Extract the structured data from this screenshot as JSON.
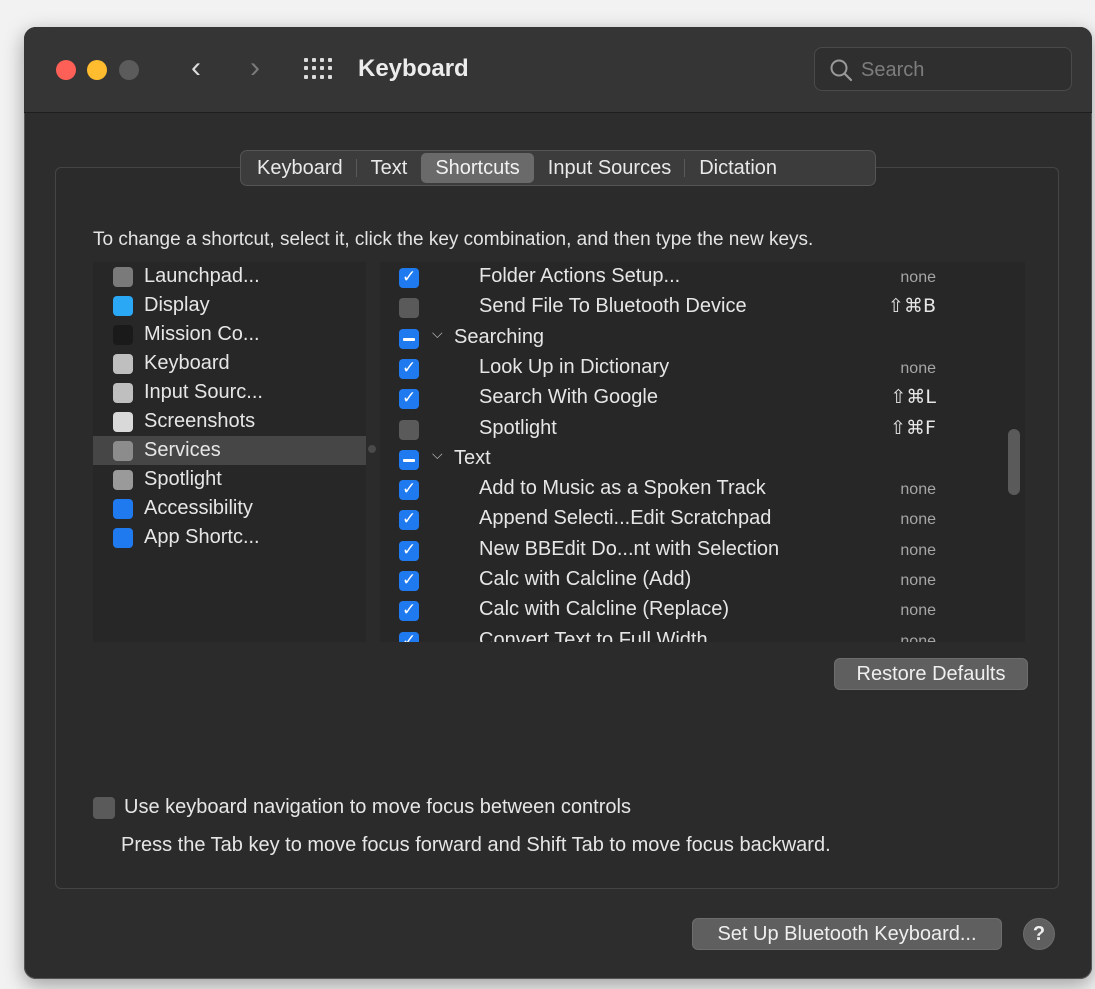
{
  "window": {
    "title": "Keyboard",
    "search_placeholder": "Search"
  },
  "tabs": [
    {
      "label": "Keyboard",
      "active": false
    },
    {
      "label": "Text",
      "active": false
    },
    {
      "label": "Shortcuts",
      "active": true
    },
    {
      "label": "Input Sources",
      "active": false
    },
    {
      "label": "Dictation",
      "active": false
    }
  ],
  "instructions": "To change a shortcut, select it, click the key combination, and then type the new keys.",
  "categories": [
    {
      "label": "Launchpad...",
      "icon": "launchpad-icon",
      "color": "#7a7a7a",
      "selected": false
    },
    {
      "label": "Display",
      "icon": "display-icon",
      "color": "#2aa7f5",
      "selected": false
    },
    {
      "label": "Mission Co...",
      "icon": "mission-control-icon",
      "color": "#1a1a1a",
      "selected": false
    },
    {
      "label": "Keyboard",
      "icon": "keyboard-icon",
      "color": "#bfbfbf",
      "selected": false
    },
    {
      "label": "Input Sourc...",
      "icon": "input-sources-icon",
      "color": "#bfbfbf",
      "selected": false
    },
    {
      "label": "Screenshots",
      "icon": "screenshots-icon",
      "color": "#d9d9d9",
      "selected": false
    },
    {
      "label": "Services",
      "icon": "services-gear-icon",
      "color": "#8c8c8c",
      "selected": true
    },
    {
      "label": "Spotlight",
      "icon": "spotlight-icon",
      "color": "#9a9a9a",
      "selected": false
    },
    {
      "label": "Accessibility",
      "icon": "accessibility-icon",
      "color": "#1f7aef",
      "selected": false
    },
    {
      "label": "App Shortc...",
      "icon": "app-shortcuts-icon",
      "color": "#1f7aef",
      "selected": false
    }
  ],
  "shortcuts": [
    {
      "kind": "item",
      "state": "checked",
      "name": "Folder Actions Setup...",
      "key": "none"
    },
    {
      "kind": "item",
      "state": "unchecked",
      "name": "Send File To Bluetooth Device",
      "key": "⇧⌘B"
    },
    {
      "kind": "group",
      "state": "mixed",
      "name": "Searching",
      "key": ""
    },
    {
      "kind": "item",
      "state": "checked",
      "name": "Look Up in Dictionary",
      "key": "none"
    },
    {
      "kind": "item",
      "state": "checked",
      "name": "Search With Google",
      "key": "⇧⌘L"
    },
    {
      "kind": "item",
      "state": "unchecked",
      "name": "Spotlight",
      "key": "⇧⌘F"
    },
    {
      "kind": "group",
      "state": "mixed",
      "name": "Text",
      "key": ""
    },
    {
      "kind": "item",
      "state": "checked",
      "name": "Add to Music as a Spoken Track",
      "key": "none"
    },
    {
      "kind": "item",
      "state": "checked",
      "name": "Append Selecti...Edit Scratchpad",
      "key": "none"
    },
    {
      "kind": "item",
      "state": "checked",
      "name": "New BBEdit Do...nt with Selection",
      "key": "none"
    },
    {
      "kind": "item",
      "state": "checked",
      "name": "Calc with Calcline (Add)",
      "key": "none"
    },
    {
      "kind": "item",
      "state": "checked",
      "name": "Calc with Calcline (Replace)",
      "key": "none"
    },
    {
      "kind": "item",
      "state": "checked",
      "name": "Convert Text to Full Width",
      "key": "none"
    }
  ],
  "buttons": {
    "restore_defaults": "Restore Defaults",
    "setup_bluetooth": "Set Up Bluetooth Keyboard...",
    "help": "?"
  },
  "keyboard_navigation": {
    "checked": false,
    "label": "Use keyboard navigation to move focus between controls",
    "hint": "Press the Tab key to move focus forward and Shift Tab to move focus backward."
  },
  "colors": {
    "accent": "#1f7aef",
    "window_bg": "#2d2d2d",
    "close": "#fe5f57",
    "minimize": "#febc2e"
  }
}
